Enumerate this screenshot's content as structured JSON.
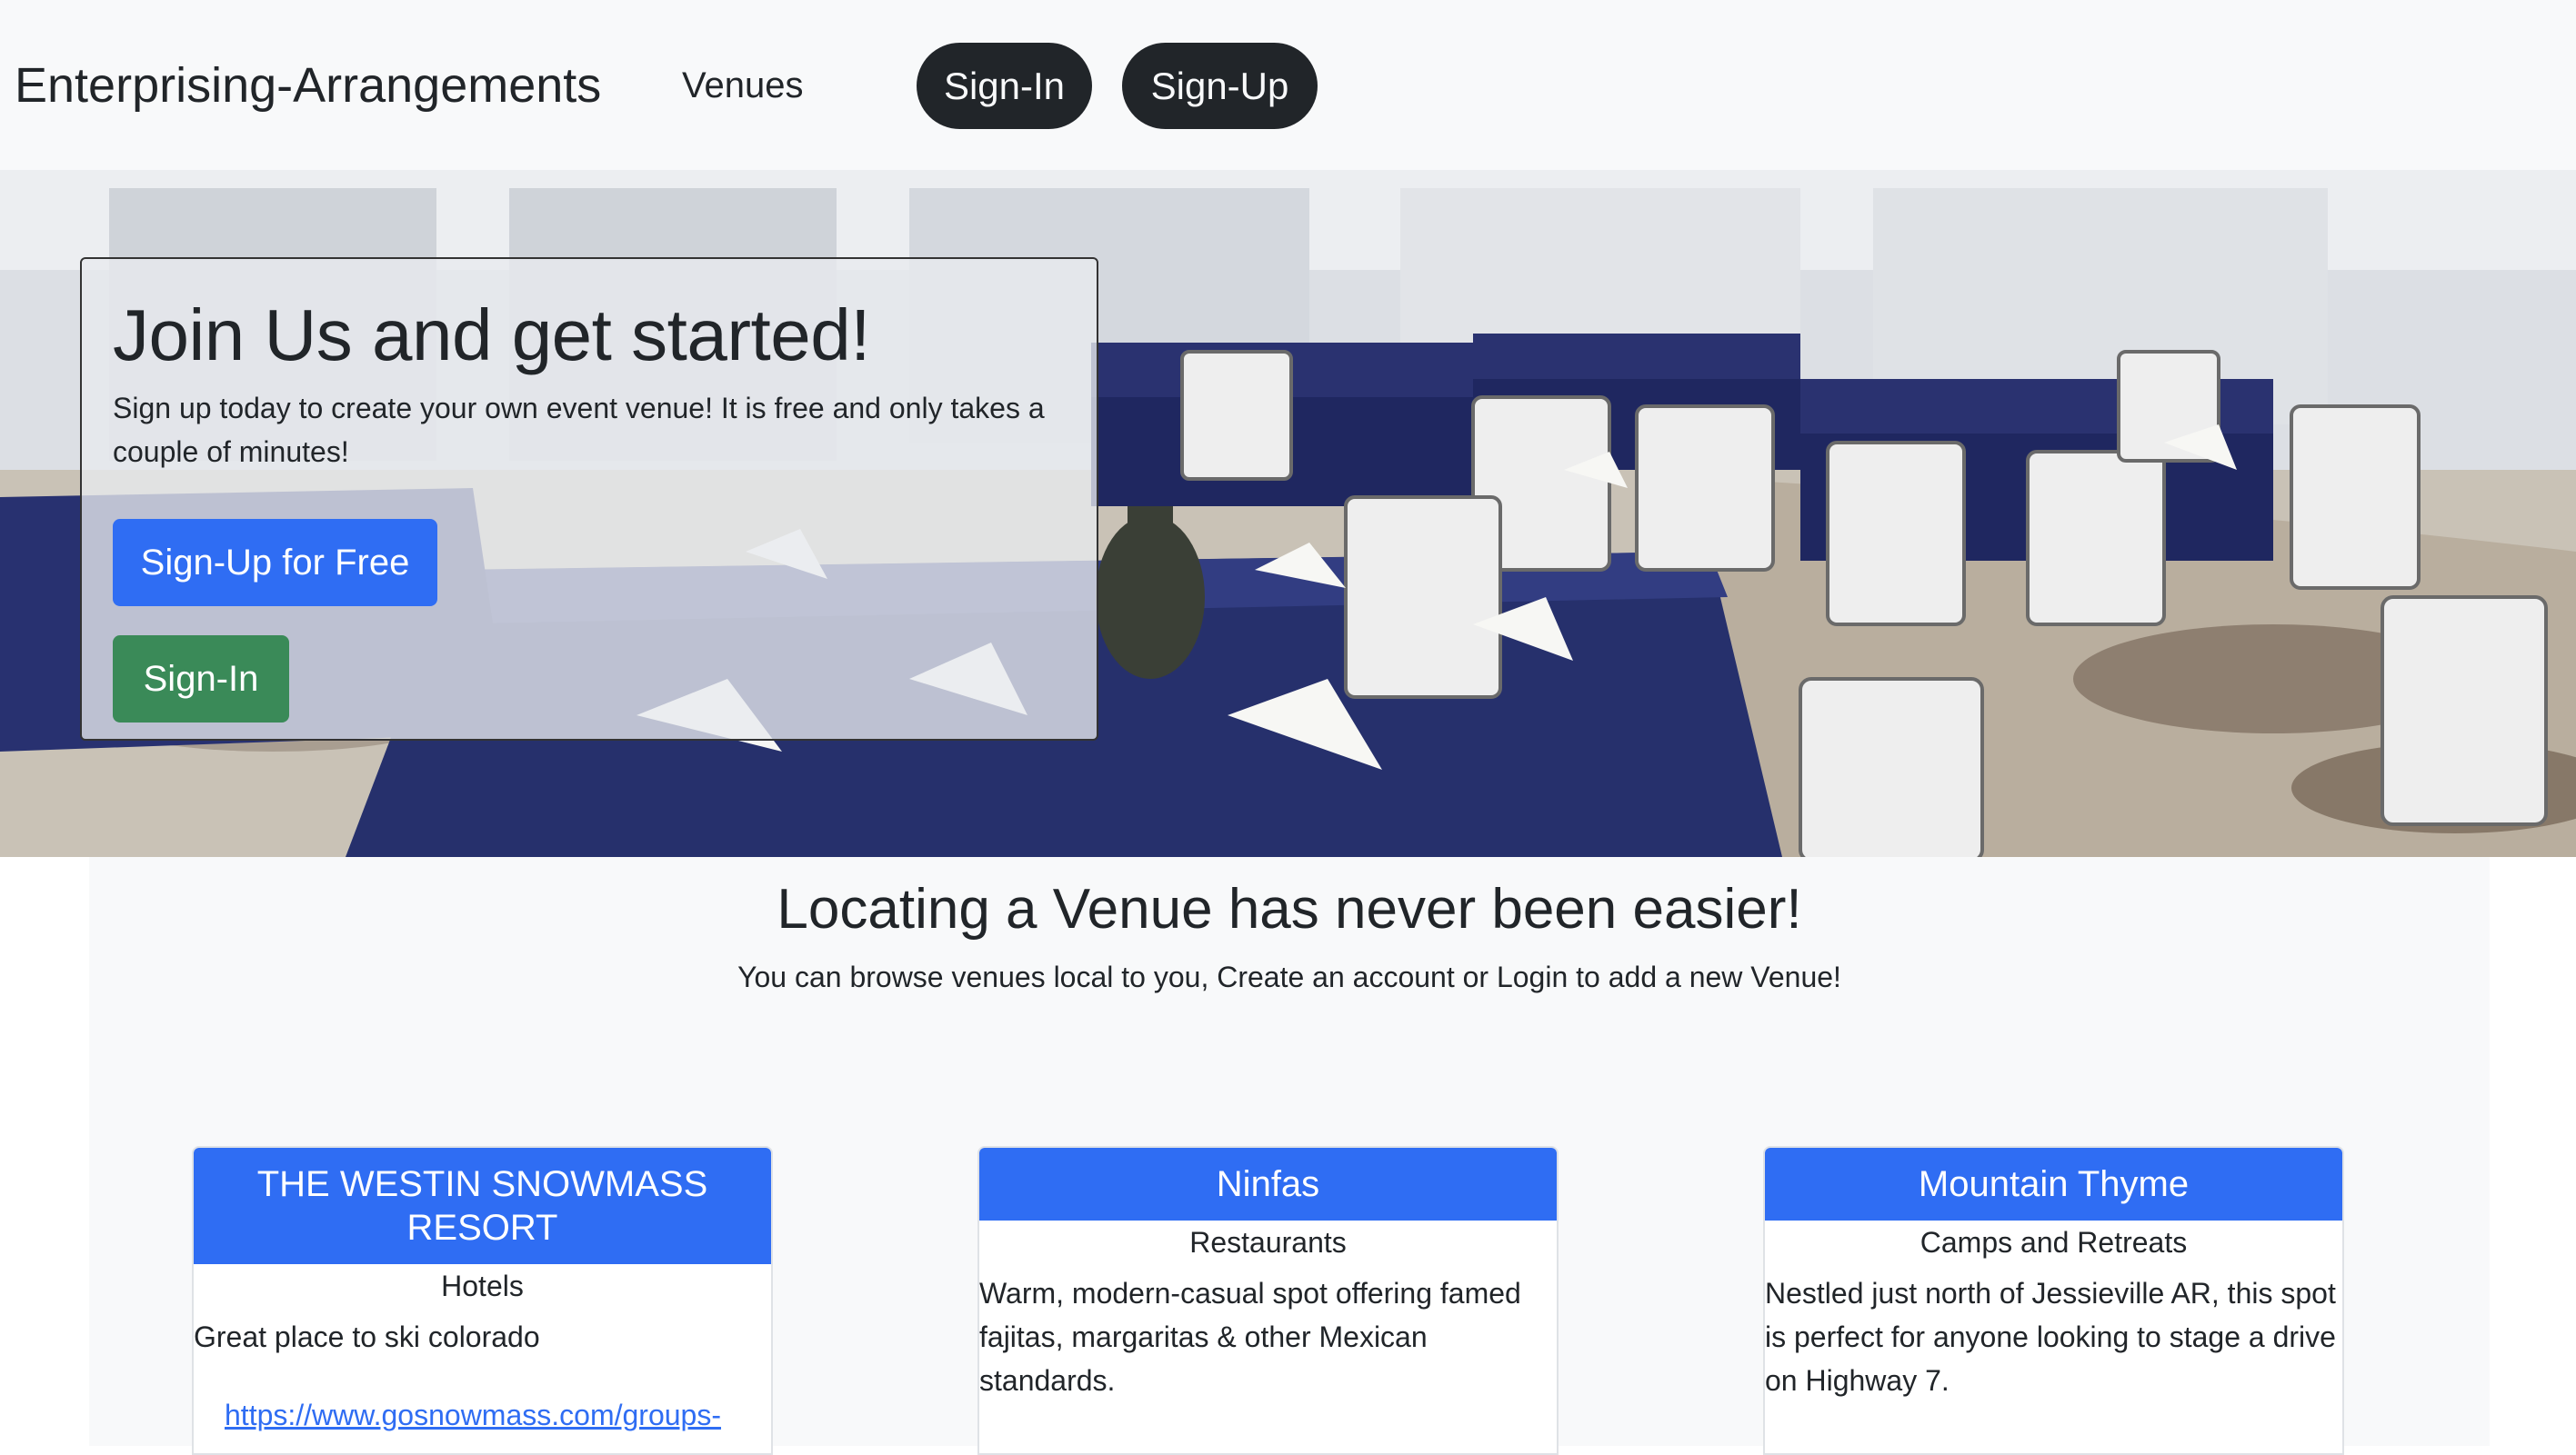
{
  "navbar": {
    "brand": "Enterprising-Arrangements",
    "links": [
      {
        "label": "Venues"
      }
    ],
    "sign_in_label": "Sign-In",
    "sign_up_label": "Sign-Up"
  },
  "hero": {
    "title": "Join Us and get started!",
    "text": "Sign up today to create your own event venue! It is free and only takes a couple of minutes!",
    "primary_button": "Sign-Up for Free",
    "secondary_button": "Sign-In"
  },
  "section": {
    "title": "Locating a Venue has never been easier!",
    "subtitle": "You can browse venues local to you, Create an account or Login to add a new Venue!"
  },
  "venues": [
    {
      "name": "THE WESTIN SNOWMASS RESORT",
      "category": "Hotels",
      "description": "Great place to ski colorado",
      "link": "https://www.gosnowmass.com/groups-"
    },
    {
      "name": "Ninfas",
      "category": "Restaurants",
      "description": "Warm, modern-casual spot offering famed fajitas, margaritas & other Mexican standards."
    },
    {
      "name": "Mountain Thyme",
      "category": "Camps and Retreats",
      "description": "Nestled just north of Jessieville AR, this spot is perfect for anyone looking to stage a drive on Highway 7."
    }
  ],
  "colors": {
    "navbar_bg": "#f8f9fa",
    "dark_pill": "#212529",
    "primary": "#2f6df3",
    "success": "#3a8a58"
  }
}
